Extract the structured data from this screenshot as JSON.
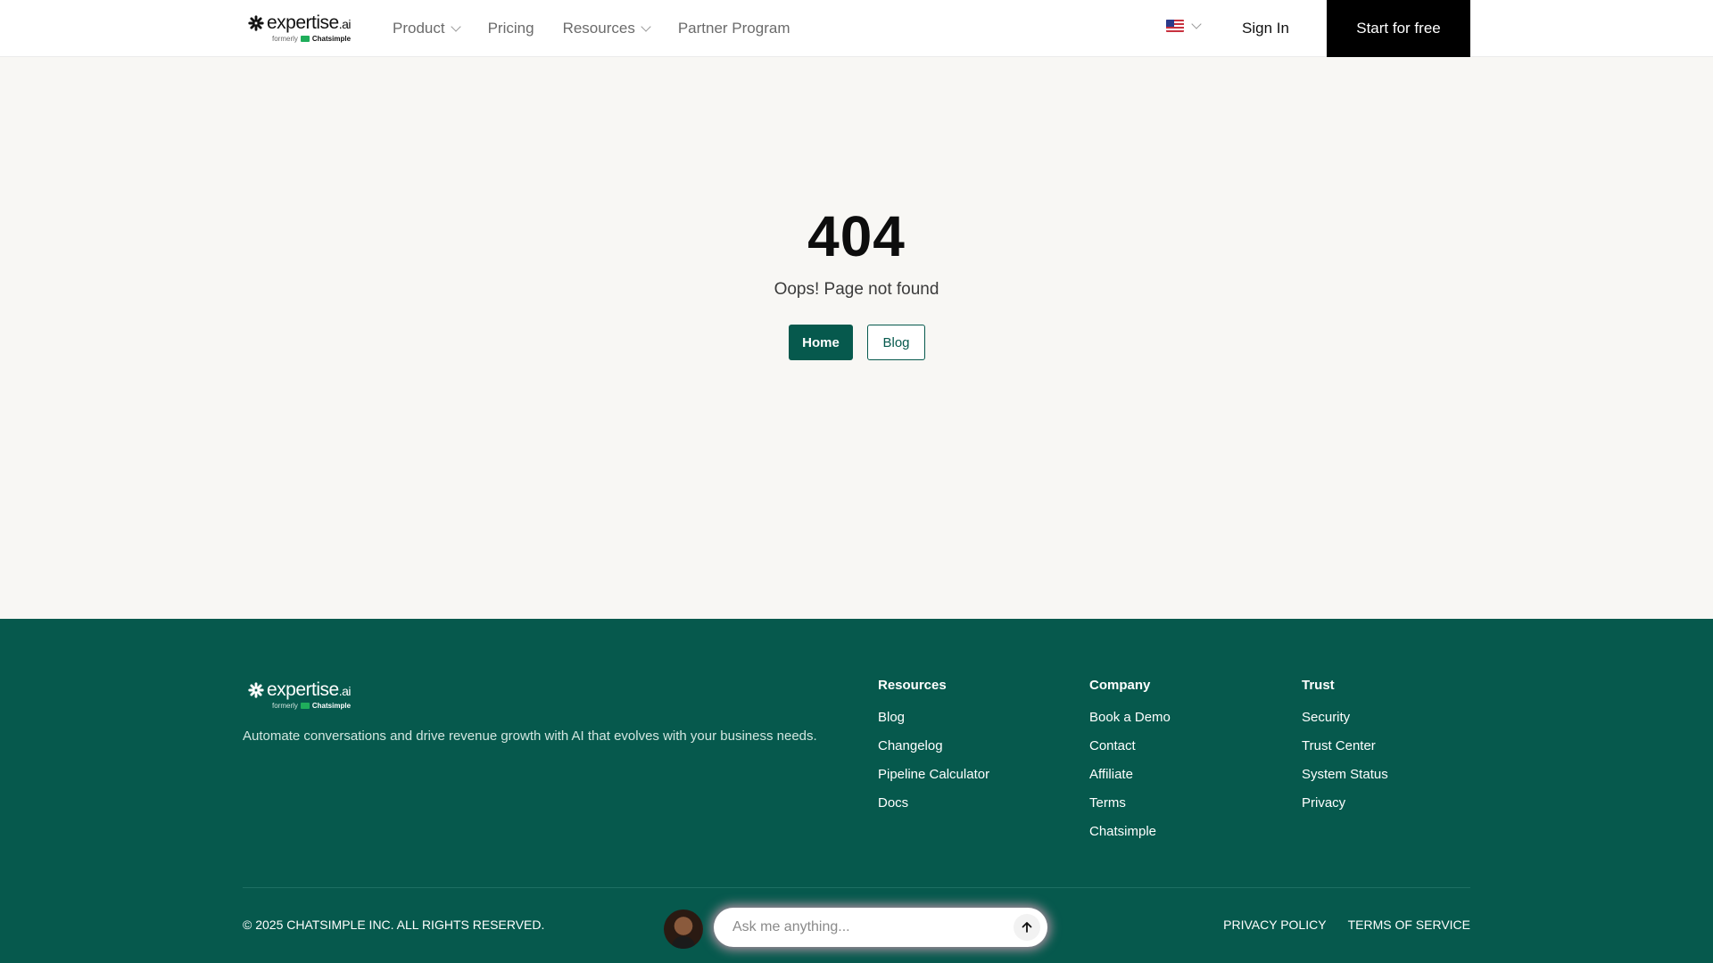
{
  "header": {
    "logo": {
      "main": "expertise",
      "suffix": ".ai",
      "formerly": "formerly",
      "brand": "Chatsimple"
    },
    "nav": [
      {
        "label": "Product",
        "has_dropdown": true
      },
      {
        "label": "Pricing",
        "has_dropdown": false
      },
      {
        "label": "Resources",
        "has_dropdown": true
      },
      {
        "label": "Partner Program",
        "has_dropdown": false
      }
    ],
    "language_icon": "us-flag-icon",
    "sign_in": "Sign In",
    "cta": "Start for free"
  },
  "main": {
    "code": "404",
    "message": "Oops! Page not found",
    "home_button": "Home",
    "blog_button": "Blog"
  },
  "footer": {
    "logo": {
      "main": "expertise",
      "suffix": ".ai",
      "formerly": "formerly",
      "brand": "Chatsimple"
    },
    "tagline": "Automate conversations and drive revenue growth with AI that evolves with your business needs.",
    "columns": [
      {
        "title": "Resources",
        "links": [
          "Blog",
          "Changelog",
          "Pipeline Calculator",
          "Docs"
        ]
      },
      {
        "title": "Company",
        "links": [
          "Book a Demo",
          "Contact",
          "Affiliate",
          "Terms",
          "Chatsimple"
        ]
      },
      {
        "title": "Trust",
        "links": [
          "Security",
          "Trust Center",
          "System Status",
          "Privacy"
        ]
      }
    ],
    "copyright": "© 2025 CHATSIMPLE INC. ALL RIGHTS RESERVED.",
    "legal": {
      "privacy": "PRIVACY POLICY",
      "terms": "TERMS OF SERVICE"
    }
  },
  "chat": {
    "placeholder": "Ask me anything...",
    "send_icon": "arrow-up-icon"
  },
  "colors": {
    "brand_green": "#06594d",
    "page_bg": "#f8f7f4",
    "cta_bg": "#000000"
  }
}
